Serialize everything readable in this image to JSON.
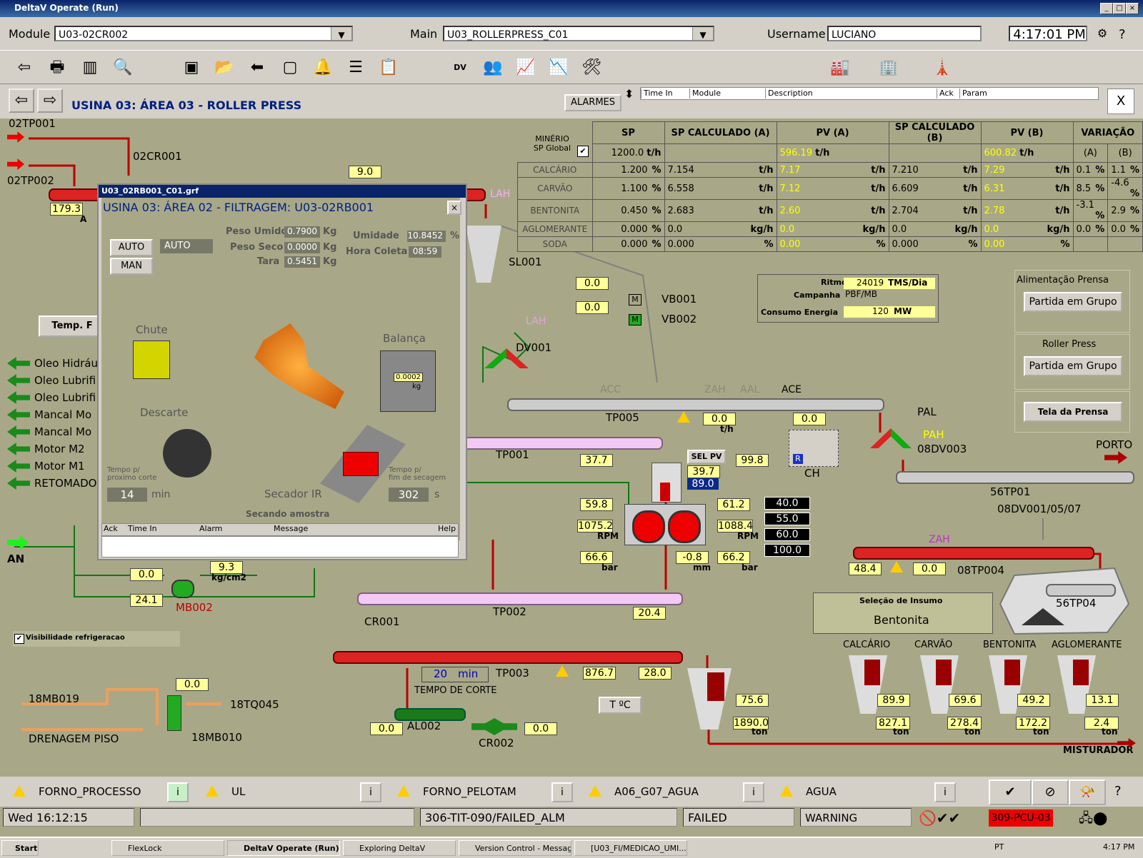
{
  "window": {
    "title": "DeltaV Operate (Run)"
  },
  "header": {
    "module_label": "Module",
    "module_value": "U03-02CR002",
    "main_label": "Main",
    "main_value": "U03_ROLLERPRESS_C01",
    "username_label": "Username",
    "username_value": "LUCIANO",
    "time": "4:17:01 PM"
  },
  "nav": {
    "title": "USINA 03:  ÁREA 03 - ROLLER PRESS",
    "alarmes": "ALARMES",
    "close": "X",
    "alarm_cols": [
      "Time In",
      "Module",
      "Description",
      "Ack",
      "Param"
    ]
  },
  "table": {
    "headers": [
      "SP",
      "SP CALCULADO (A)",
      "PV (A)",
      "SP CALCULADO (B)",
      "PV (B)",
      "VARIAÇÃO",
      "(A)",
      "(B)"
    ],
    "minerio_label": "MINÉRIO\nSP Global",
    "minerio_sp": "1200.0",
    "minerio_unit": "t/h",
    "minerio_pva": "596.19",
    "minerio_pvb": "600.82",
    "th": "t/h",
    "rows": [
      {
        "name": "CALCÁRIO",
        "sp": "1.200",
        "spa": "7.154",
        "pva": "7.17",
        "spb": "7.210",
        "pvb": "7.29",
        "va": "0.1",
        "vb": "1.1",
        "u": "t/h"
      },
      {
        "name": "CARVÃO",
        "sp": "1.100",
        "spa": "6.558",
        "pva": "7.12",
        "spb": "6.609",
        "pvb": "6.31",
        "va": "8.5",
        "vb": "-4.6",
        "u": "t/h"
      },
      {
        "name": "BENTONITA",
        "sp": "0.450",
        "spa": "2.683",
        "pva": "2.60",
        "spb": "2.704",
        "pvb": "2.78",
        "va": "-3.1",
        "vb": "2.9",
        "u": "t/h"
      },
      {
        "name": "AGLOMERANTE",
        "sp": "0.000",
        "spa": "0.0",
        "pva": "0.0",
        "spb": "0.0",
        "pvb": "0.0",
        "va": "0.0",
        "vb": "0.0",
        "u": "kg/h"
      },
      {
        "name": "SODA",
        "sp": "0.000",
        "spa": "0.000",
        "pva": "0.00",
        "spb": "0.000",
        "pvb": "0.00",
        "va": "",
        "vb": "",
        "u": "%"
      }
    ],
    "pct": "%"
  },
  "info": {
    "ritmo_label": "Ritmo",
    "ritmo_value": "24019",
    "ritmo_unit": "TMS/Dia",
    "campanha_label": "Campanha",
    "campanha_value": "PBF/MB",
    "consumo_label": "Consumo Energia",
    "consumo_value": "120",
    "consumo_unit": "MW"
  },
  "right_panel": {
    "alim_label": "Alimentação  Prensa",
    "partida1": "Partida em Grupo",
    "roller_label": "Roller Press",
    "partida2": "Partida em Grupo",
    "tela": "Tela da Prensa"
  },
  "popup": {
    "titlebar": "U03_02RB001_C01.grf",
    "title": "USINA 03:  ÁREA 02 - FILTRAGEM: U03-02RB001",
    "auto_btn": "AUTO",
    "man_btn": "MAN",
    "auto_status": "AUTO",
    "peso_umido_label": "Peso Umido",
    "peso_umido": "0.7900",
    "peso_seco_label": "Peso Seco",
    "peso_seco": "0.0000",
    "tara_label": "Tara",
    "tara": "0.5451",
    "kg": "Kg",
    "umidade_label": "Umidade",
    "umidade": "10.8452",
    "pct": "%",
    "hora_label": "Hora Coleta",
    "hora": "08:59",
    "chute": "Chute",
    "balanca": "Balança",
    "balanca_value": "0.0002",
    "balanca_unit": "kg",
    "descarte": "Descarte",
    "secador": "Secador IR",
    "tempo1_label": "Tempo p/\nproximo corte",
    "tempo1": "14",
    "min": "min",
    "tempo2_label": "Tempo p/\nfim de secagem",
    "tempo2": "302",
    "s": "s",
    "secando": "Secando amostra",
    "cols": [
      "Ack",
      "Time In",
      "Alarm",
      "Message",
      "Help"
    ]
  },
  "process": {
    "tp001_top": "02TP001",
    "tp002_top": "02TP002",
    "cr001": "02CR001",
    "v179": "179.3",
    "v90": "9.0",
    "sl001": "SL001",
    "vb001": "VB001",
    "vb002": "VB002",
    "v00a": "0.0",
    "v00b": "0.0",
    "dv001": "DV001",
    "tp005": "TP005",
    "tp001": "TP001",
    "tp002": "TP002",
    "tp003": "TP003",
    "pal": "PAL",
    "pah": "PAH",
    "dv003": "08DV003",
    "ch": "CH",
    "porto": "PORTO",
    "tp56": "56TP01",
    "dv_list": "08DV001/05/07",
    "tp08": "08TP004",
    "tp56_4": "56TP04",
    "v484": "48.4",
    "v00c": "0.0",
    "v00d": "0.0",
    "v00e": "0.0",
    "v377": "37.7",
    "v998": "99.8",
    "selpv": "SEL PV",
    "v397": "39.7",
    "v890": "89.0",
    "v598": "59.8",
    "v612": "61.2",
    "v10752": "1075.2",
    "v10884": "1088.4",
    "rpm": "RPM",
    "v666": "66.6",
    "v662": "66.2",
    "bar": "bar",
    "vm08": "-0.8",
    "mm": "mm",
    "b400": "40.0",
    "b550": "55.0",
    "b600": "60.0",
    "b1000": "100.0",
    "v204": "20.4",
    "v93": "9.3",
    "kgcm2": "kg/cm2",
    "v00f": "0.0",
    "v241": "24.1",
    "mb002": "MB002",
    "cr001b": "CR001",
    "tempo_corte_value": "20",
    "tempo_corte_unit": "min",
    "tempo_corte": "TEMPO DE CORTE",
    "v8767": "876.7",
    "v280": "28.0",
    "al002": "AL002",
    "cr002": "CR002",
    "v00g": "0.0",
    "v00h": "0.0",
    "sel_insumo": "Seleção de Insumo",
    "bentonita": "Bentonita",
    "tc": "T ºC",
    "silos": [
      {
        "name": "CALCÁRIO",
        "pct": "89.9",
        "ton": "827.1"
      },
      {
        "name": "CARVÃO",
        "pct": "69.6",
        "ton": "278.4"
      },
      {
        "name": "BENTONITA",
        "pct": "49.2",
        "ton": "172.2"
      },
      {
        "name": "AGLOMERANTE",
        "pct": "13.1",
        "ton": "2.4"
      }
    ],
    "silo_main_pct": "75.6",
    "silo_main_ton": "1890.0",
    "ton": "ton",
    "misturador": "MISTURADOR",
    "mb019": "18MB019",
    "tq045": "18TQ045",
    "mb010": "18MB010",
    "drenagem": "DRENAGEM PISO",
    "v00i": "0.0",
    "an": "AN",
    "visib": "Visibilidade refrigeracao",
    "left_items": [
      "Oleo Hidráu",
      "Oleo Lubrifi",
      "Oleo Lubrifi",
      "Mancal Mo",
      "Mancal Mo",
      "Motor M2",
      "Motor M1",
      "RETOMADOR"
    ],
    "temp": "Temp. F",
    "ah": "A",
    "th": "t/h",
    "pct": "%"
  },
  "status": {
    "items": [
      "FORNO_PROCESSO",
      "UL",
      "FORNO_PELOTAM",
      "A06_G07_AGUA",
      "AGUA"
    ],
    "date": "Wed 16:12:15",
    "tag": "306-TIT-090/FAILED_ALM",
    "failed": "FAILED",
    "warning": "WARNING",
    "pcu": "309-PCU-03"
  },
  "taskbar": {
    "start": "Start",
    "tasks": [
      "FlexLock",
      "DeltaV Operate (Run)",
      "Exploring DeltaV",
      "Version Control - Messages",
      "[U03_FI/MEDICAO_UMI..."
    ],
    "lang": "PT",
    "clock": "4:17 PM"
  }
}
